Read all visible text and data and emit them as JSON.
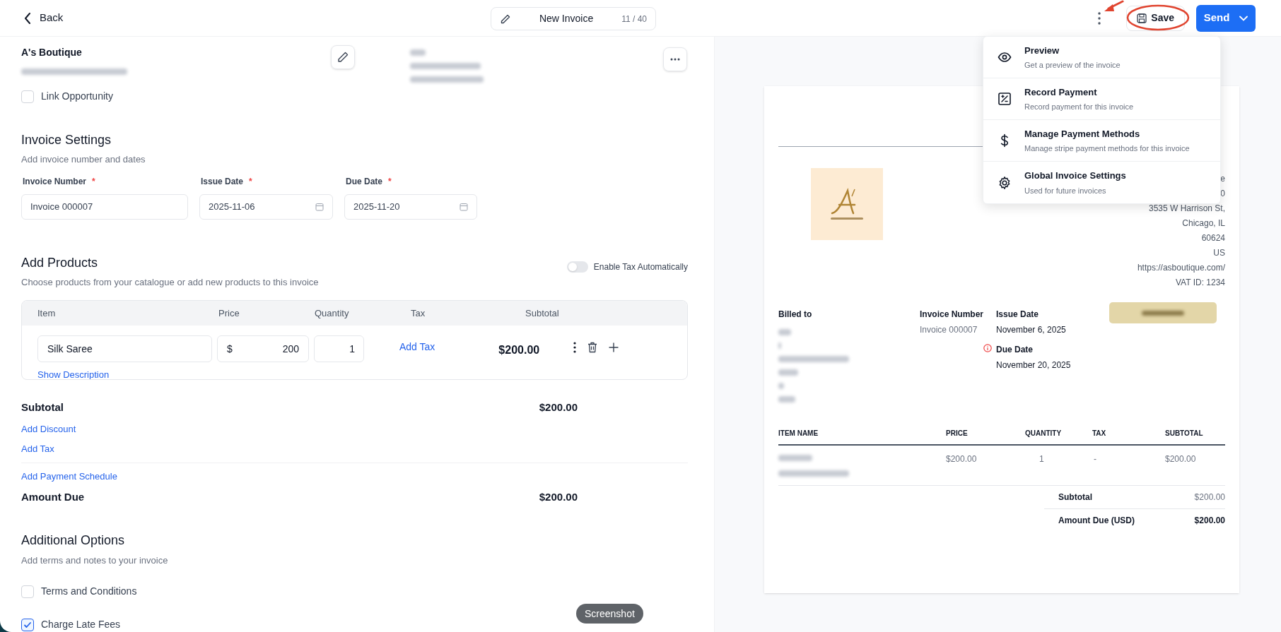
{
  "header": {
    "back": "Back",
    "title": "New Invoice",
    "title_count": "11 / 40",
    "save": "Save",
    "send": "Send"
  },
  "customer": {
    "business_name": "A's Boutique"
  },
  "link_opportunity": {
    "label": "Link Opportunity",
    "checked": false
  },
  "invoice_settings": {
    "title": "Invoice Settings",
    "subtitle": "Add invoice number and dates",
    "fields": [
      {
        "label": "Invoice Number",
        "required_mark": "*",
        "value": "Invoice 000007",
        "kind": "text"
      },
      {
        "label": "Issue Date",
        "required_mark": "*",
        "value": "2025-11-06",
        "kind": "date"
      },
      {
        "label": "Due Date",
        "required_mark": "*",
        "value": "2025-11-20",
        "kind": "date"
      }
    ]
  },
  "products": {
    "title": "Add Products",
    "subtitle": "Choose products from your catalogue or add new products to this invoice",
    "auto_tax": {
      "label": "Enable Tax Automatically",
      "on": false
    },
    "columns": [
      "Item",
      "Price",
      "Quantity",
      "Tax",
      "Subtotal"
    ],
    "rows": [
      {
        "item": "Silk Saree",
        "currency": "$",
        "price": "200",
        "quantity": "1",
        "tax_action": "Add Tax",
        "subtotal": "$200.00",
        "description_action": "Show Description"
      }
    ]
  },
  "summary": {
    "subtotal_label": "Subtotal",
    "subtotal": "$200.00",
    "actions": [
      "Add Discount",
      "Add Tax"
    ],
    "schedule_action": "Add Payment Schedule",
    "amount_due_label": "Amount Due",
    "amount_due": "$200.00"
  },
  "additional_options": {
    "title": "Additional Options",
    "subtitle": "Add terms and notes to your invoice",
    "options": [
      {
        "label": "Terms and Conditions",
        "checked": false
      },
      {
        "label": "Charge Late Fees",
        "checked": true
      }
    ]
  },
  "tooltip": "Screenshot",
  "menu": {
    "items": [
      {
        "title": "Preview",
        "subtitle": "Get a preview of the invoice"
      },
      {
        "title": "Record Payment",
        "subtitle": "Record payment for this invoice"
      },
      {
        "title": "Manage Payment Methods",
        "subtitle": "Manage stripe payment methods for this invoice"
      },
      {
        "title": "Global Invoice Settings",
        "subtitle": "Used for future invoices"
      }
    ]
  },
  "preview": {
    "address_lines": [
      "e",
      "0",
      "3535 W Harrison St,",
      "Chicago, IL",
      "60624",
      "US",
      "https://asboutique.com/",
      "VAT ID: 1234"
    ],
    "billed_to_label": "Billed to",
    "invoice_number_label": "Invoice Number",
    "invoice_number": "Invoice 000007",
    "issue_date_label": "Issue Date",
    "issue_date": "November 6, 2025",
    "due_date_label": "Due Date",
    "due_date": "November 20, 2025",
    "columns": [
      "ITEM NAME",
      "PRICE",
      "QUANTITY",
      "TAX",
      "SUBTOTAL"
    ],
    "rows": [
      {
        "price": "$200.00",
        "quantity": "1",
        "tax": "-",
        "subtotal": "$200.00"
      }
    ],
    "totals": [
      {
        "label": "Subtotal",
        "value": "$200.00",
        "kind": "subtotal"
      },
      {
        "label": "Amount Due (USD)",
        "value": "$200.00",
        "kind": "total"
      }
    ]
  }
}
